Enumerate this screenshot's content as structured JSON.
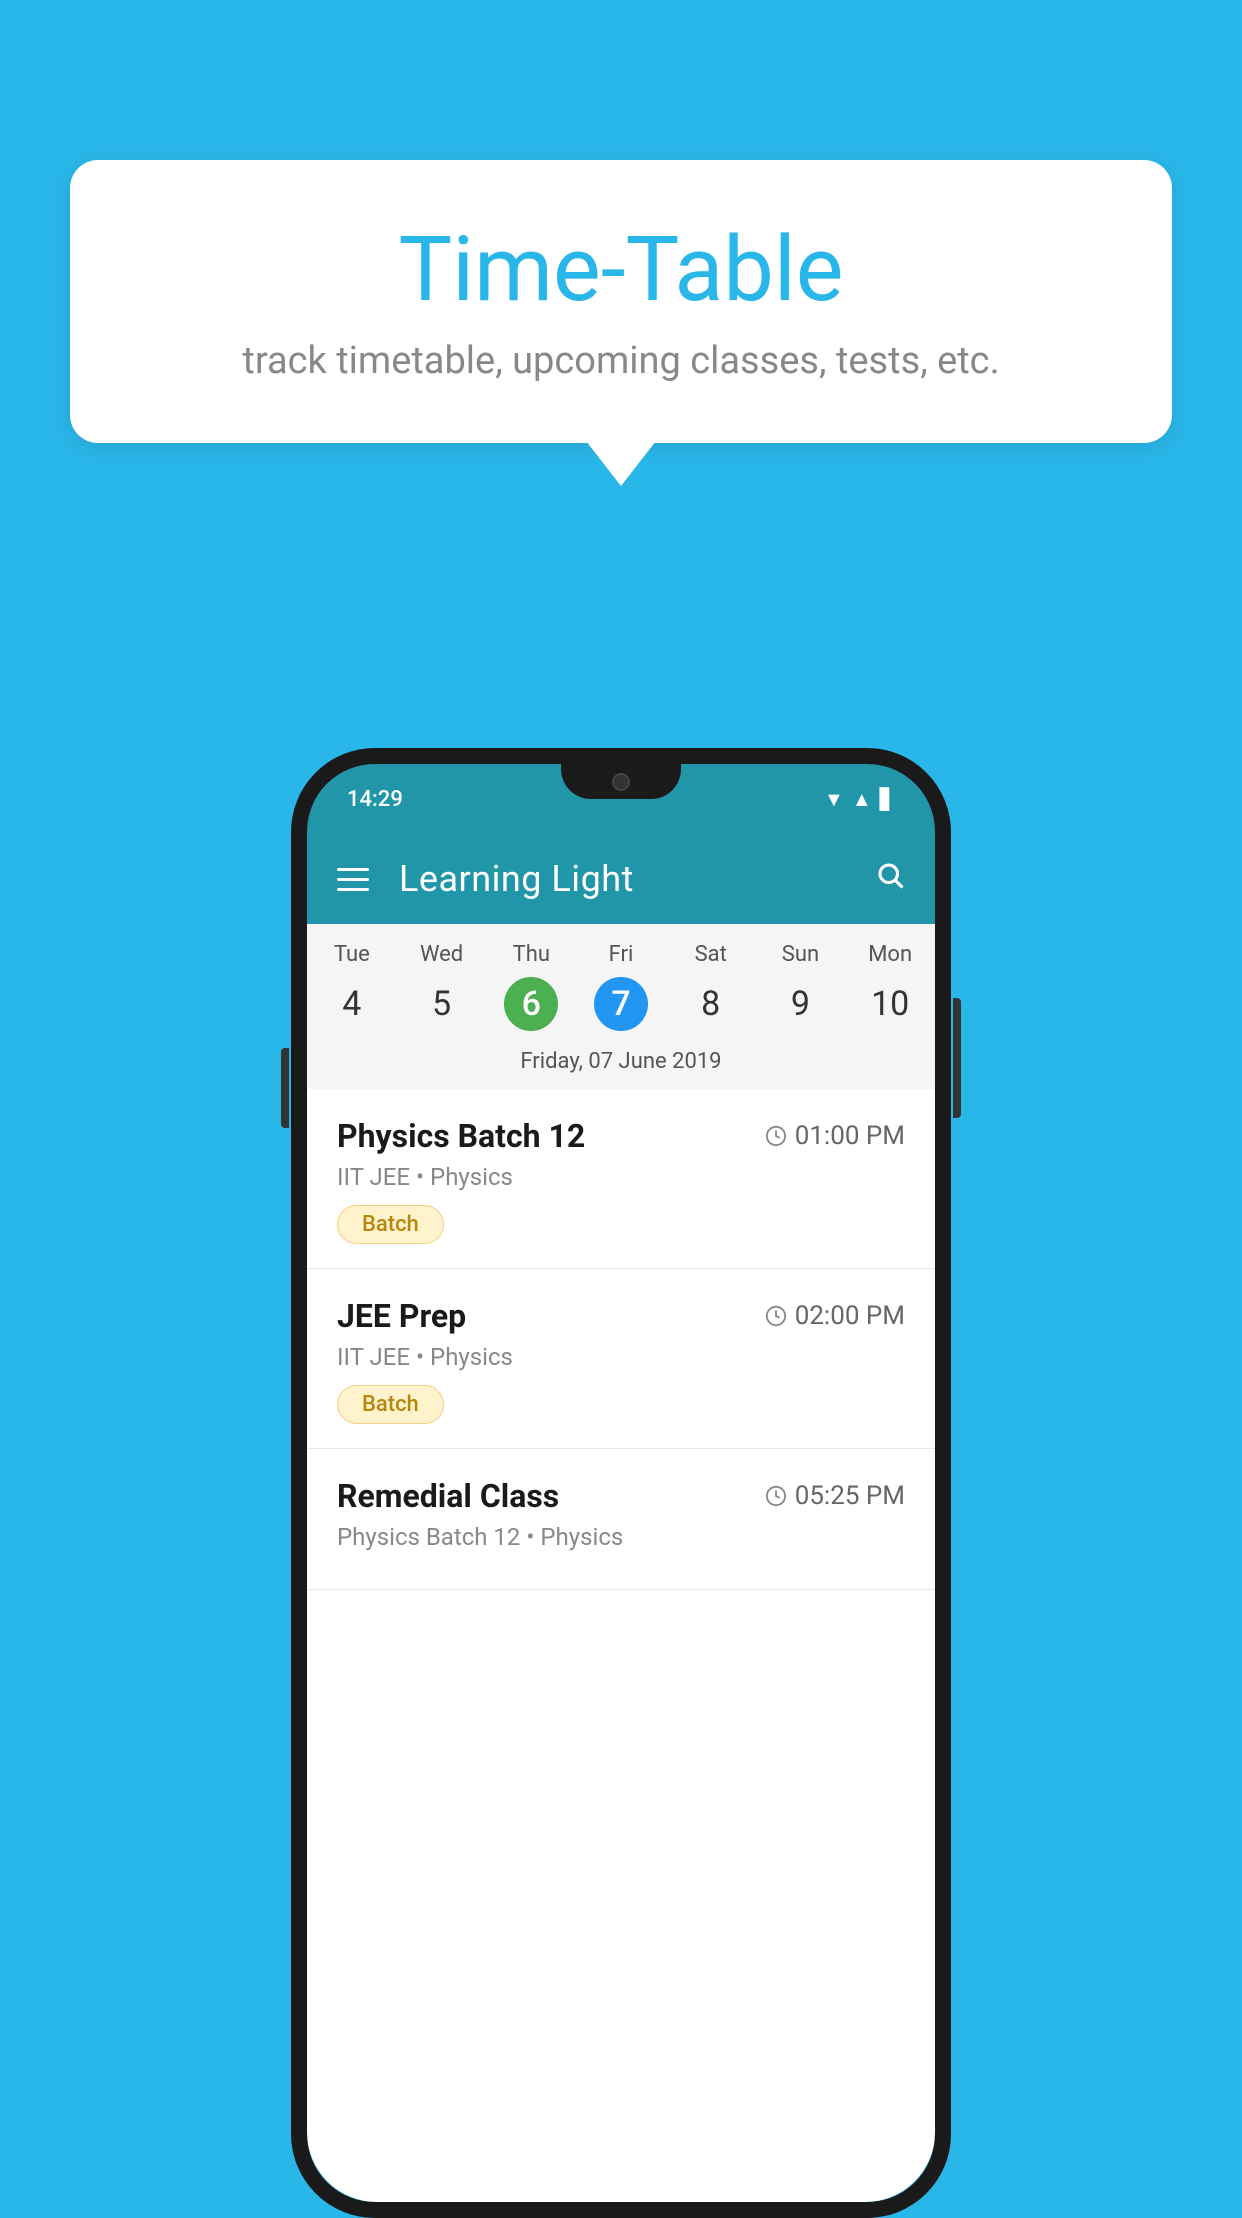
{
  "background_color": "#29b6e8",
  "bubble": {
    "title": "Time-Table",
    "subtitle": "track timetable, upcoming classes, tests, etc."
  },
  "phone": {
    "status_bar": {
      "time": "14:29"
    },
    "app_bar": {
      "title": "Learning Light"
    },
    "calendar": {
      "days": [
        {
          "name": "Tue",
          "num": "4",
          "state": "normal"
        },
        {
          "name": "Wed",
          "num": "5",
          "state": "normal"
        },
        {
          "name": "Thu",
          "num": "6",
          "state": "today"
        },
        {
          "name": "Fri",
          "num": "7",
          "state": "selected"
        },
        {
          "name": "Sat",
          "num": "8",
          "state": "normal"
        },
        {
          "name": "Sun",
          "num": "9",
          "state": "normal"
        },
        {
          "name": "Mon",
          "num": "10",
          "state": "normal"
        }
      ],
      "selected_date_label": "Friday, 07 June 2019"
    },
    "schedule": [
      {
        "title": "Physics Batch 12",
        "time": "01:00 PM",
        "subtitle": "IIT JEE • Physics",
        "tag": "Batch"
      },
      {
        "title": "JEE Prep",
        "time": "02:00 PM",
        "subtitle": "IIT JEE • Physics",
        "tag": "Batch"
      },
      {
        "title": "Remedial Class",
        "time": "05:25 PM",
        "subtitle": "Physics Batch 12 • Physics",
        "tag": ""
      }
    ]
  }
}
